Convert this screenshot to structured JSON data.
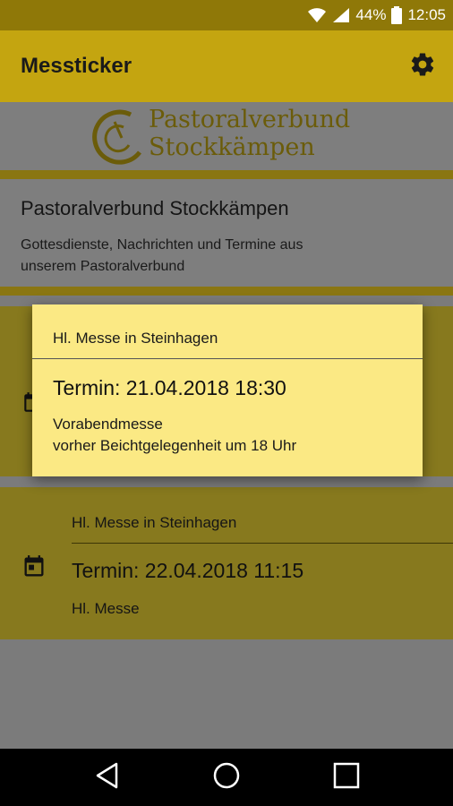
{
  "status_bar": {
    "battery": "44%",
    "time": "12:05"
  },
  "app_bar": {
    "title": "Messticker",
    "settings_icon": "gear-icon"
  },
  "logo": {
    "line1": "Pastoralverbund",
    "line2": "Stockkämpen"
  },
  "info": {
    "title": "Pastoralverbund Stockkämpen",
    "description_line1": "Gottesdienste, Nachrichten und Termine aus",
    "description_line2": "unserem Pastoralverbund"
  },
  "events": [
    {
      "location": "Hl. Messe in Steinhagen",
      "date": "Termin: 22.04.2018 11:15",
      "description": "Hl. Messe"
    }
  ],
  "popup": {
    "location": "Hl. Messe in Steinhagen",
    "date": "Termin: 21.04.2018 18:30",
    "description_line1": "Vorabendmesse",
    "description_line2": "vorher Beichtgelegenheit um 18 Uhr"
  },
  "colors": {
    "accent": "#c4a510",
    "popup_bg": "#fbe984",
    "status_bar": "#8f7808"
  }
}
